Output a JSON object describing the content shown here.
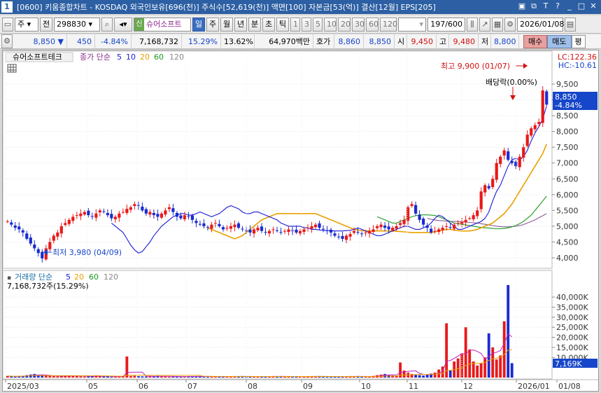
{
  "window": {
    "index": "1",
    "title": "[0600] 키움종합차트 - KOSDAQ 외국인보유[696(천)] 주식수[52,619(천)] 액면[100] 자본금[53(억)] 결산[12월] EPS[205]"
  },
  "toolbar": {
    "market": "주",
    "all_label": "전",
    "code": "298830",
    "stock_prefix": "신",
    "stock_name": "슈어소프트",
    "periods": [
      "일",
      "주",
      "월",
      "년",
      "분",
      "초",
      "틱"
    ],
    "active_period": "일",
    "intervals": [
      "1",
      "3",
      "5",
      "10",
      "20",
      "30",
      "60",
      "120"
    ],
    "count": "197/600",
    "date": "2026/01/08"
  },
  "quote": {
    "price": "8,850",
    "arrow": "▼",
    "change": "450",
    "change_pct": "-4.84%",
    "volume": "7,168,732",
    "turnover_pct": "15.29%",
    "rotation_pct": "13.62%",
    "amount": "64,970백만",
    "hoga_label": "호가",
    "bid": "8,860",
    "ask": "8,850",
    "open_label": "시",
    "open": "9,450",
    "high_label": "고",
    "high": "9,480",
    "low_label": "저",
    "low": "8,800",
    "buy_label": "매수",
    "sell_label": "매도",
    "pyeong_label": "평"
  },
  "price_panel": {
    "name_tab": "슈어소프트테크",
    "ma_legend_title": "종가 단순",
    "ma_periods": [
      "5",
      "10",
      "20",
      "60",
      "120"
    ],
    "lc": "LC:122.36",
    "hc": "HC:-10.61",
    "max_label": "최고 9,900 (01/07)",
    "min_label": "최저 3,980 (04/09)",
    "dividend_label": "배당락(0.00%)",
    "current_price": "8,850",
    "current_pct": "-4.84%",
    "y_ticks": [
      "9,500",
      "9,000",
      "8,500",
      "8,000",
      "7,500",
      "7,000",
      "6,500",
      "6,000",
      "5,500",
      "5,000",
      "4,500",
      "4,000"
    ]
  },
  "volume_panel": {
    "title": "거래량 단순",
    "ma_periods": [
      "5",
      "20",
      "60",
      "120"
    ],
    "volume_text": "7,168,732주(15.29%)",
    "current": "7,169K",
    "y_ticks": [
      "40,000K",
      "35,000K",
      "30,000K",
      "25,000K",
      "20,000K",
      "15,000K",
      "10,000K"
    ]
  },
  "x_axis": [
    "2025/03",
    "05",
    "06",
    "07",
    "08",
    "09",
    "10",
    "11",
    "12",
    "2026/01",
    "01/08"
  ],
  "colors": {
    "up": "#e8191a",
    "down": "#1a2bd0",
    "ma5": "#1a1ad8",
    "ma10": "#e8191a",
    "ma20": "#e8a000",
    "ma60": "#1b9a1b",
    "ma120": "#8a5a9a"
  },
  "chart_data": {
    "type": "candlestick",
    "x_range": [
      "2025/03",
      "2026/01/08"
    ],
    "price_ylim": [
      3800,
      9900
    ],
    "volume_ylim": [
      0,
      47000
    ],
    "series": [
      {
        "name": "종가",
        "values": [
          5150,
          5050,
          4950,
          4900,
          4800,
          4600,
          4450,
          4300,
          4150,
          3980,
          4300,
          4500,
          4700,
          4800,
          5000,
          5100,
          5200,
          5300,
          5350,
          5400,
          5450,
          5350,
          5300,
          5400,
          5500,
          5450,
          5350,
          5250,
          5300,
          5400,
          5450,
          5550,
          5600,
          5700,
          5650,
          5500,
          5400,
          5450,
          5350,
          5300,
          5400,
          5500,
          5600,
          5450,
          5300,
          5250,
          5350,
          5300,
          5200,
          5100,
          5050,
          5000,
          4950,
          5050,
          5100,
          5000,
          4900,
          4950,
          5000,
          5050,
          4950,
          4900,
          4850,
          4800,
          4900,
          4950,
          4850,
          4800,
          4850,
          4900,
          4850,
          4800,
          4850,
          4900,
          4850,
          4800,
          4850,
          4900,
          4950,
          5000,
          5050,
          4950,
          4900,
          4850,
          4800,
          4700,
          4650,
          4600,
          4700,
          4750,
          4850,
          4800,
          4750,
          4800,
          4850,
          4900,
          5000,
          5050,
          4950,
          4900,
          4950,
          5000,
          5100,
          5200,
          5600,
          5700,
          5400,
          5200,
          5050,
          4950,
          4800,
          4850,
          4900,
          4950,
          5000,
          4950,
          5050,
          5100,
          5150,
          5200,
          5250,
          5350,
          5500,
          6100,
          6300,
          6200,
          6500,
          7000,
          7200,
          7400,
          7100,
          7000,
          6900,
          7200,
          7500,
          7900,
          8100,
          8200,
          8300,
          9300,
          8850
        ]
      },
      {
        "name": "5",
        "values": [
          5100,
          5000,
          4900,
          4800,
          4600,
          4400,
          4250,
          4150,
          4200,
          4350,
          4500,
          4700,
          4850,
          5000,
          5100,
          5200,
          5300,
          5350,
          5400,
          5400,
          5350,
          5350,
          5400,
          5450,
          5400,
          5350,
          5300,
          5350,
          5400,
          5500,
          5600,
          5650,
          5600,
          5550,
          5450,
          5400,
          5400,
          5450,
          5450,
          5400,
          5350,
          5300,
          5250,
          5200,
          5100,
          5050,
          5000,
          5000,
          5000,
          5000,
          4950,
          4950,
          4900,
          4900,
          4880,
          4870,
          4860,
          4860,
          4850,
          4850,
          4850,
          4860,
          4870,
          4900,
          4950,
          4900,
          4850,
          4800,
          4750,
          4700,
          4700,
          4750,
          4800,
          4850,
          4900,
          4950,
          5000,
          5000,
          4950,
          4900,
          4900,
          4950,
          5000,
          5100,
          5250,
          5350,
          5300,
          5200,
          5100,
          5000,
          4900,
          4900,
          4950,
          5000,
          5050,
          5100,
          5150,
          5250,
          5450,
          5800,
          6100,
          6300,
          6600,
          6900,
          7100,
          7150,
          7100,
          7200,
          7400,
          7700,
          7950,
          8150,
          8400,
          8800
        ]
      },
      {
        "name": "20",
        "values": [
          4950,
          4900,
          4850,
          4800,
          4750,
          4700,
          4650,
          4600,
          4650,
          4700,
          4800,
          4900,
          5000,
          5100,
          5200,
          5250,
          5300,
          5350,
          5400,
          5400,
          5400,
          5400,
          5400,
          5400,
          5400,
          5400,
          5400,
          5400,
          5400,
          5350,
          5300,
          5250,
          5200,
          5150,
          5100,
          5050,
          5000,
          4950,
          4900,
          4880,
          4860,
          4850,
          4850,
          4850,
          4850,
          4850,
          4850,
          4850,
          4850,
          4840,
          4830,
          4820,
          4810,
          4800,
          4800,
          4800,
          4800,
          4800,
          4800,
          4820,
          4850,
          4880,
          4900,
          4900,
          4880,
          4860,
          4850,
          4850,
          4850,
          4870,
          4900,
          4950,
          5000,
          5050,
          5100,
          5200,
          5300,
          5400,
          5550,
          5700,
          5900,
          6100,
          6300,
          6500,
          6700,
          6900,
          7100,
          7300,
          7600
        ]
      },
      {
        "name": "60",
        "values": [
          5300,
          5250,
          5200,
          5150,
          5100,
          5100,
          5150,
          5200,
          5250,
          5300,
          5330,
          5350,
          5360,
          5360,
          5350,
          5340,
          5300,
          5250,
          5200,
          5150,
          5100,
          5080,
          5060,
          5040,
          5020,
          5000,
          4980,
          4960,
          4950,
          4940,
          4930,
          4920,
          4920,
          4930,
          4950,
          4980,
          5020,
          5080,
          5150,
          5250,
          5350,
          5500,
          5650,
          5800,
          5950
        ]
      },
      {
        "name": "120",
        "values": [
          5250,
          5220,
          5200,
          5180,
          5170,
          5160,
          5150,
          5150,
          5150,
          5140,
          5130,
          5120,
          5110,
          5100,
          5080,
          5060,
          5040,
          5020,
          5000,
          4990,
          4980,
          4980,
          4990,
          5000,
          5020,
          5050,
          5100,
          5150,
          5200,
          5270,
          5330,
          5400
        ]
      },
      {
        "name": "거래량",
        "values": [
          800,
          600,
          500,
          700,
          900,
          1200,
          1500,
          1800,
          1300,
          1000,
          900,
          800,
          700,
          600,
          700,
          900,
          1100,
          900,
          700,
          600,
          500,
          600,
          700,
          1100,
          600,
          500,
          500,
          400,
          500,
          600,
          700,
          10500,
          800,
          900,
          700,
          600,
          500,
          600,
          700,
          800,
          600,
          500,
          400,
          500,
          600,
          500,
          400,
          500,
          600,
          700,
          600,
          500,
          400,
          500,
          600,
          500,
          400,
          500,
          600,
          700,
          600,
          500,
          400,
          500,
          600,
          500,
          400,
          500,
          600,
          700,
          600,
          500,
          400,
          500,
          600,
          500,
          400,
          500,
          600,
          700,
          600,
          500,
          400,
          500,
          600,
          500,
          400,
          500,
          600,
          700,
          600,
          500,
          400,
          500,
          600,
          800,
          1200,
          1500,
          1800,
          1300,
          1000,
          800,
          7500,
          3500,
          2500,
          1800,
          1500,
          1200,
          1000,
          1500,
          2000,
          2500,
          4000,
          5500,
          27000,
          3500,
          8000,
          9500,
          12000,
          25000,
          14000,
          8000,
          6000,
          7000,
          10000,
          22000,
          15000,
          9000,
          11000,
          28000,
          46000,
          7169
        ]
      }
    ]
  }
}
